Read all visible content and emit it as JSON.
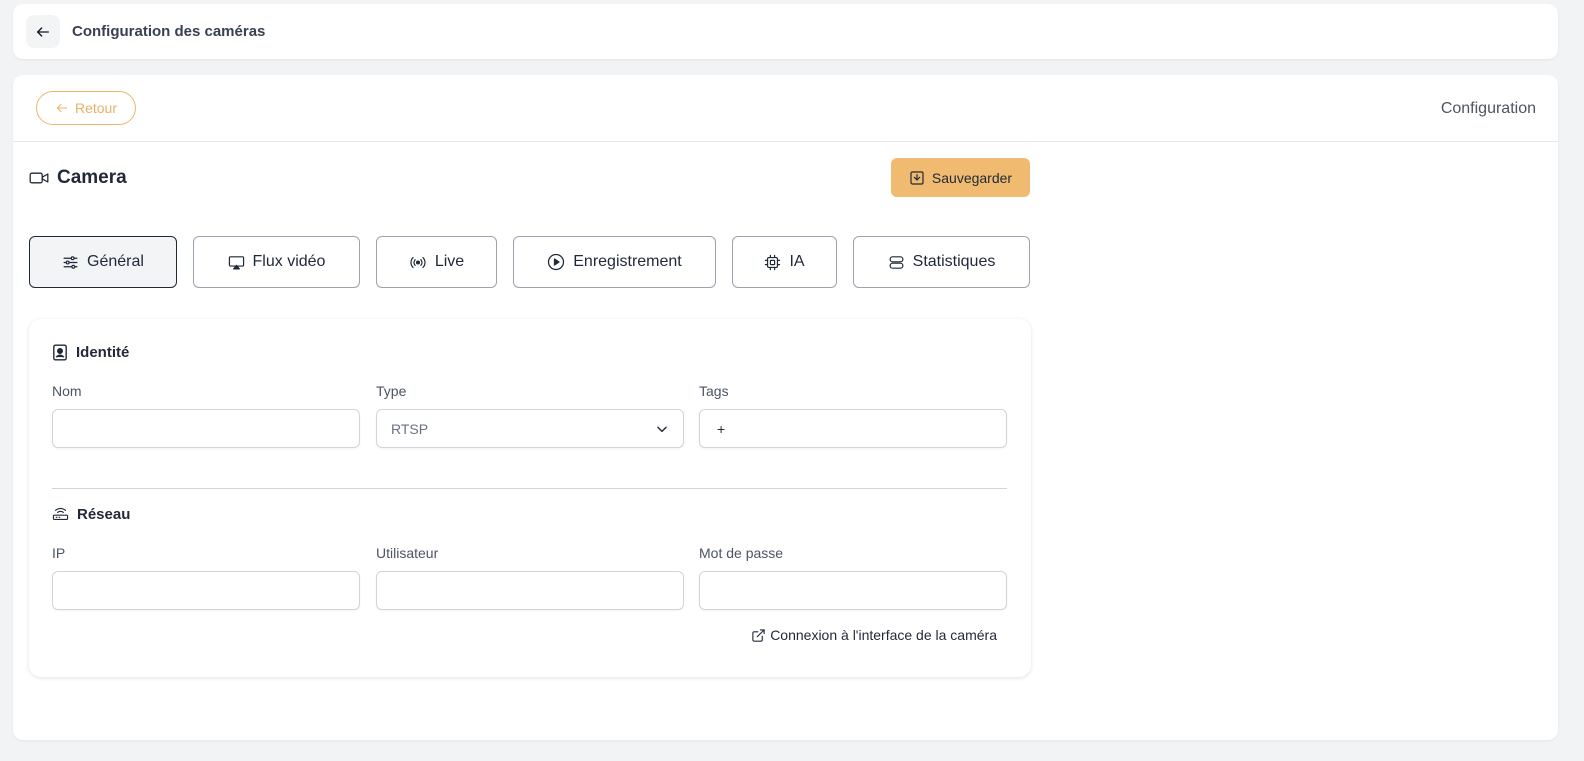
{
  "topbar": {
    "title": "Configuration des caméras",
    "back_icon": "arrow-left-icon"
  },
  "header": {
    "back_label": "Retour",
    "right_label": "Configuration"
  },
  "camera": {
    "title": "Camera",
    "save_label": "Sauvegarder"
  },
  "tabs": [
    {
      "label": "Général",
      "icon": "sliders-icon",
      "active": true
    },
    {
      "label": "Flux vidéo",
      "icon": "monitor-icon",
      "active": false
    },
    {
      "label": "Live",
      "icon": "broadcast-icon",
      "active": false
    },
    {
      "label": "Enregistrement",
      "icon": "play-circle-icon",
      "active": false
    },
    {
      "label": "IA",
      "icon": "cpu-icon",
      "active": false
    },
    {
      "label": "Statistiques",
      "icon": "server-icon",
      "active": false
    }
  ],
  "identity": {
    "title": "Identité",
    "name_label": "Nom",
    "name_value": "",
    "type_label": "Type",
    "type_value": "RTSP",
    "tags_label": "Tags",
    "tags_add": "+"
  },
  "network": {
    "title": "Réseau",
    "ip_label": "IP",
    "ip_value": "",
    "user_label": "Utilisateur",
    "user_value": "",
    "password_label": "Mot de passe",
    "password_value": "",
    "link_label": "Connexion à l'interface de la caméra"
  },
  "colors": {
    "accent": "#f0bb70",
    "accent_border": "#e9b86a",
    "background": "#f1f3f5"
  }
}
